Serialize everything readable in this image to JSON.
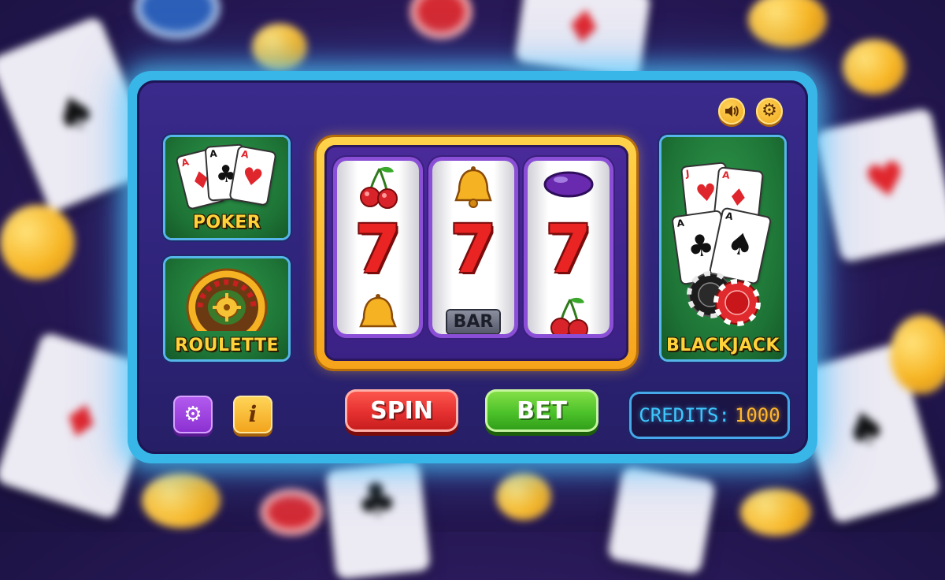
{
  "game": {
    "tiles": {
      "poker": "POKER",
      "roulette": "ROULETTE",
      "blackjack": "BLACKJACK"
    },
    "reels": [
      {
        "top": "cherry",
        "middle": "7",
        "bottom": "bell"
      },
      {
        "top": "bell",
        "middle": "7",
        "bottom_label": "BAR"
      },
      {
        "top": "plum",
        "middle": "7",
        "bottom": "cherry"
      }
    ],
    "buttons": {
      "spin": "SPIN",
      "bet": "BET"
    },
    "credits": {
      "label": "CREDITS:",
      "value": "1000"
    },
    "icons": {
      "sound": "speaker-icon",
      "settings": "gear-icon",
      "info": "info-icon"
    },
    "cards": {
      "poker": [
        {
          "rank": "A",
          "suit": "♦"
        },
        {
          "rank": "A",
          "suit": "♣"
        },
        {
          "rank": "A",
          "suit": "♥"
        }
      ],
      "blackjack": [
        {
          "rank": "J",
          "suit": "♥"
        },
        {
          "rank": "A",
          "suit": "♦"
        },
        {
          "rank": "A",
          "suit": "♣"
        },
        {
          "rank": "A",
          "suit": "♠"
        }
      ]
    },
    "colors": {
      "panel_border": "#38b6e8",
      "tile_green": "#1d7235",
      "gold": "#ffd23a",
      "spin_red": "#e53030",
      "bet_green": "#4cc22a",
      "credits_text": "#3ec8ff",
      "credits_value": "#ffb62a"
    }
  }
}
